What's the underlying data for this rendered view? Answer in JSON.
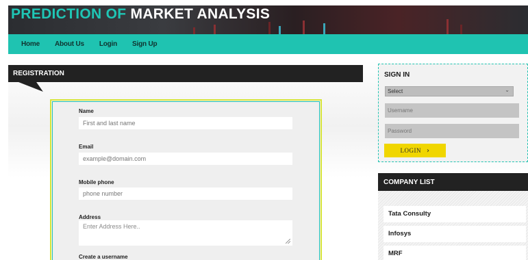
{
  "header": {
    "title_part1": "PREDICTION OF ",
    "title_part2": "MARKET ANALYSIS"
  },
  "nav": {
    "items": [
      "Home",
      "About Us",
      "Login",
      "Sign Up"
    ]
  },
  "registration": {
    "heading": "REGISTRATION",
    "fields": [
      {
        "label": "Name",
        "placeholder": "First and last name"
      },
      {
        "label": "Email",
        "placeholder": "example@domain.com"
      },
      {
        "label": "Mobile phone",
        "placeholder": "phone number"
      },
      {
        "label": "Address",
        "placeholder": "Enter Address Here.."
      },
      {
        "label": "Create a username"
      }
    ]
  },
  "signin": {
    "heading": "SIGN IN",
    "select_value": "Select",
    "username_placeholder": "Username",
    "password_placeholder": "Password",
    "login_label": "LOGIN",
    "login_arrow": "›"
  },
  "companies": {
    "heading": "COMPANY LIST",
    "items": [
      "Tata Consulty",
      "Infosys",
      "MRF"
    ]
  },
  "colors": {
    "accent": "#1fc3b1",
    "dark": "#222222",
    "login_button": "#f0d600"
  }
}
